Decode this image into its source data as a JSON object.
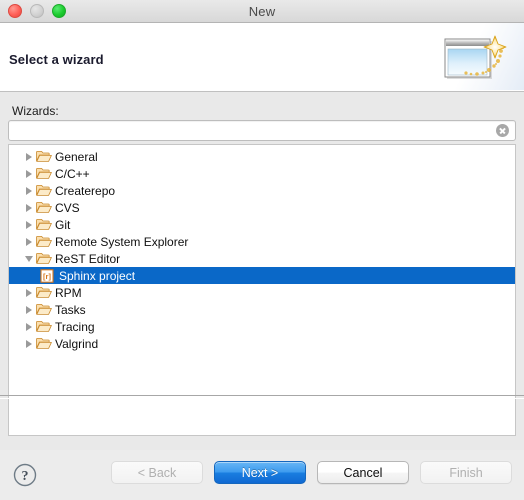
{
  "window": {
    "title": "New",
    "controls": [
      {
        "name": "close",
        "color": "#ff5f57"
      },
      {
        "name": "minimize",
        "color": "#d2d2d2"
      },
      {
        "name": "zoom",
        "color": "#1bcc2e"
      }
    ]
  },
  "header": {
    "title": "Select a wizard",
    "icon": "wizard-window-sparkle-icon"
  },
  "body": {
    "wizards_label": "Wizards:",
    "search": {
      "value": "",
      "placeholder": "",
      "clear_icon": "clear-circle-icon"
    }
  },
  "tree": {
    "selection_color": "#0a68c8",
    "items": [
      {
        "label": "General",
        "level": 0,
        "state": "collapsed",
        "icon": "folder-icon",
        "selected": false
      },
      {
        "label": "C/C++",
        "level": 0,
        "state": "collapsed",
        "icon": "folder-icon",
        "selected": false
      },
      {
        "label": "Createrepo",
        "level": 0,
        "state": "collapsed",
        "icon": "folder-icon",
        "selected": false
      },
      {
        "label": "CVS",
        "level": 0,
        "state": "collapsed",
        "icon": "folder-icon",
        "selected": false
      },
      {
        "label": "Git",
        "level": 0,
        "state": "collapsed",
        "icon": "folder-icon",
        "selected": false
      },
      {
        "label": "Remote System Explorer",
        "level": 0,
        "state": "collapsed",
        "icon": "folder-icon",
        "selected": false
      },
      {
        "label": "ReST Editor",
        "level": 0,
        "state": "expanded",
        "icon": "folder-icon",
        "selected": false
      },
      {
        "label": "Sphinx project",
        "level": 1,
        "state": "leaf",
        "icon": "rest-document-icon",
        "selected": true
      },
      {
        "label": "RPM",
        "level": 0,
        "state": "collapsed",
        "icon": "folder-icon",
        "selected": false
      },
      {
        "label": "Tasks",
        "level": 0,
        "state": "collapsed",
        "icon": "folder-icon",
        "selected": false
      },
      {
        "label": "Tracing",
        "level": 0,
        "state": "collapsed",
        "icon": "folder-icon",
        "selected": false
      },
      {
        "label": "Valgrind",
        "level": 0,
        "state": "collapsed",
        "icon": "folder-icon",
        "selected": false
      }
    ]
  },
  "footer": {
    "help_icon": "question-mark-icon",
    "buttons": [
      {
        "label": "< Back",
        "style": "disabled"
      },
      {
        "label": "Next >",
        "style": "default"
      },
      {
        "label": "Cancel",
        "style": "normal"
      },
      {
        "label": "Finish",
        "style": "disabled"
      }
    ]
  }
}
